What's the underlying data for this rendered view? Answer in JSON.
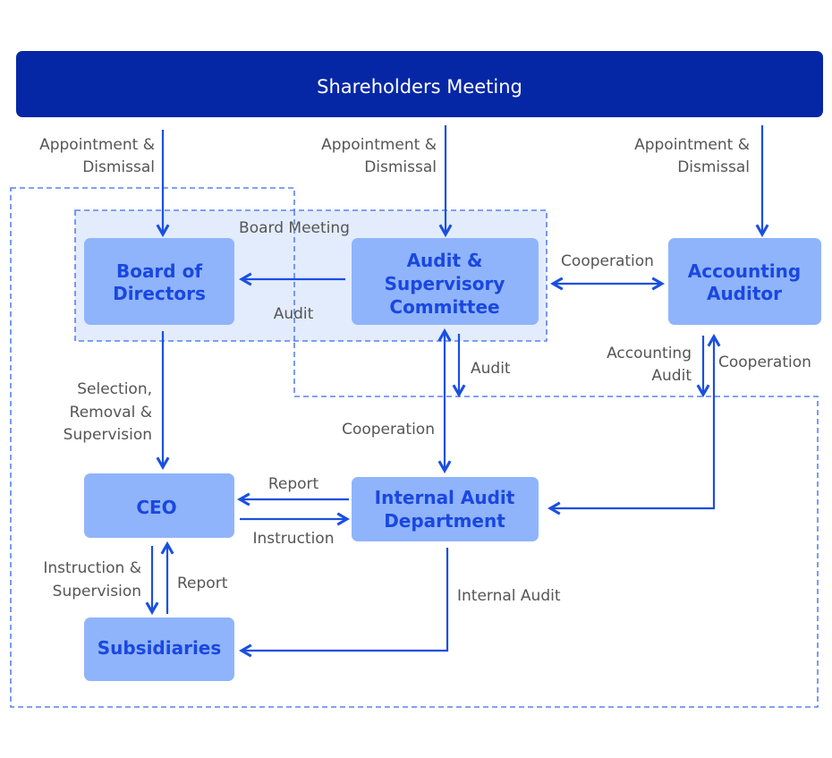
{
  "header": {
    "title": "Shareholders Meeting"
  },
  "colors": {
    "header": "#0527a6",
    "box": "#8fb4fb",
    "box_text": "#1a47e0",
    "arrow": "#1a4fe0",
    "board_meeting_fill": "#e3ecfd",
    "dashed": "#5a82f0"
  },
  "groups": {
    "board_meeting": "Board Meeting"
  },
  "nodes": {
    "board": [
      "Board of",
      "Directors"
    ],
    "asc": [
      "Audit &",
      "Supervisory",
      "Committee"
    ],
    "auditor": [
      "Accounting",
      "Auditor"
    ],
    "ceo": [
      "CEO"
    ],
    "iad": [
      "Internal Audit",
      "Department"
    ],
    "subsidiaries": [
      "Subsidiaries"
    ]
  },
  "labels": {
    "appoint1": [
      "Appointment &",
      "Dismissal"
    ],
    "appoint2": [
      "Appointment &",
      "Dismissal"
    ],
    "appoint3": [
      "Appointment &",
      "Dismissal"
    ],
    "audit_board": "Audit",
    "coop_auditor": "Cooperation",
    "selection": [
      "Selection,",
      "Removal &",
      "Supervision"
    ],
    "audit_iad": "Audit",
    "coop_iad": "Cooperation",
    "accounting_audit": [
      "Accounting",
      "Audit"
    ],
    "coop_auditor_iad": "Cooperation",
    "report_ceo": "Report",
    "instruction": "Instruction",
    "instr_sup": [
      "Instruction &",
      "Supervision"
    ],
    "report_sub": "Report",
    "internal_audit": "Internal Audit"
  }
}
